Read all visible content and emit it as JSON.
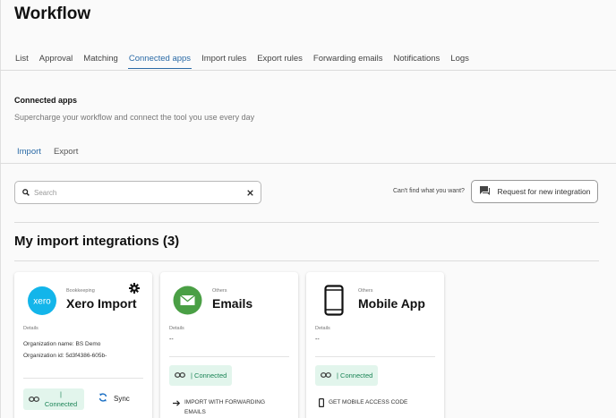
{
  "page": {
    "title": "Workflow"
  },
  "tabs": [
    "List",
    "Approval",
    "Matching",
    "Connected apps",
    "Import rules",
    "Export rules",
    "Forwarding emails",
    "Notifications",
    "Logs"
  ],
  "active_tab": "Connected apps",
  "section": {
    "title": "Connected apps",
    "subtitle": "Supercharge your workflow and connect the tool you use every day"
  },
  "subtabs": [
    "Import",
    "Export"
  ],
  "active_subtab": "Import",
  "search": {
    "placeholder": "Search",
    "value": ""
  },
  "cant_find": "Can't find what you want?",
  "request_button": "Request for new integration",
  "heading": "My import integrations (3)",
  "cards": [
    {
      "category": "Bookkeeping",
      "name": "Xero Import",
      "logo_text": "xero",
      "details_label": "Details",
      "org_name": "Organization name: BS Demo",
      "org_id": "Organization id: 5d3f4386-605b-",
      "status": "| Connected",
      "sync_label": "Sync"
    },
    {
      "category": "Others",
      "name": "Emails",
      "details_label": "Details",
      "details_value": "--",
      "status": "| Connected",
      "action": "IMPORT WITH FORWARDING EMAILS"
    },
    {
      "category": "Others",
      "name": "Mobile App",
      "details_label": "Details",
      "details_value": "--",
      "status": "| Connected",
      "action": "GET MOBILE ACCESS CODE"
    }
  ],
  "colors": {
    "accent": "#2a6aa6",
    "xero_blue": "#13b5ea",
    "email_green": "#4a9f45",
    "connected_bg": "#e2f5ec",
    "connected_text": "#1b8456"
  }
}
